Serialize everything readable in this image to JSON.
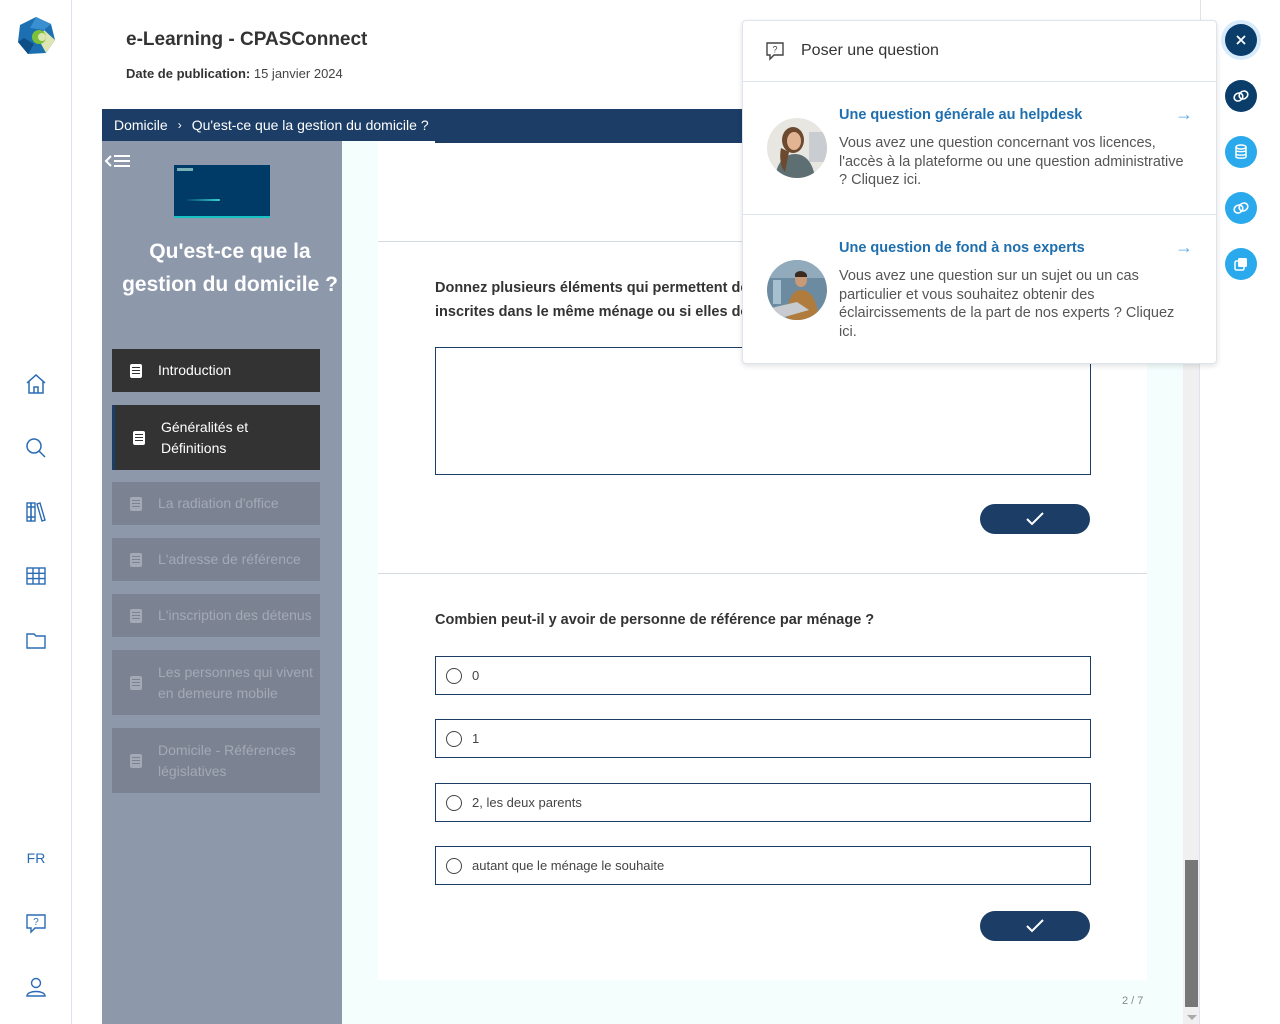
{
  "rail": {
    "logo": "cpas-logo",
    "icons": [
      "home-icon",
      "search-icon",
      "library-icon",
      "grid-icon",
      "folder-icon"
    ],
    "language": "FR",
    "bottom_icons": [
      "help-question-icon",
      "user-icon"
    ]
  },
  "header": {
    "title": "e-Learning - CPASConnect",
    "publication_label": "Date de publication:",
    "publication_date": "15 janvier 2024"
  },
  "breadcrumb": {
    "items": [
      "Domicile",
      "Qu'est-ce que la gestion du domicile ?"
    ]
  },
  "course": {
    "title": "Qu'est-ce que la gestion du domicile ?",
    "chapters": [
      {
        "label": "Introduction",
        "state": "active"
      },
      {
        "label": "Généralités et Définitions",
        "state": "current"
      },
      {
        "label": "La radiation d'office",
        "state": "locked"
      },
      {
        "label": "L'adresse de référence",
        "state": "locked"
      },
      {
        "label": "L'inscription des détenus",
        "state": "locked"
      },
      {
        "label": "Les personnes qui vivent en demeure mobile",
        "state": "locked"
      },
      {
        "label": "Domicile - Références législatives",
        "state": "locked"
      }
    ]
  },
  "content": {
    "question1": {
      "text": "Donnez plusieurs éléments qui permettent de déterminer si des personnes doivent être inscrites dans le même ménage ou si elles doivent être inscrites séparément ?",
      "visible_text_line1": "Donnez plusieurs éléments qui permettent de",
      "visible_text_line2": "inscrites dans le même ménage ou si elles doi",
      "answer_value": ""
    },
    "question2": {
      "text": "Combien peut-il y avoir de personne de référence par ménage ?",
      "options": [
        "0",
        "1",
        "2, les deux parents",
        "autant que le ménage le souhaite"
      ],
      "selected": null
    },
    "submit_icon": "check-icon",
    "pager": "2 / 7"
  },
  "popup": {
    "title": "Poser une question",
    "icon": "question-bubble-icon",
    "items": [
      {
        "title": "Une question générale au helpdesk",
        "description": "Vous avez une question concernant vos licences, l'accès à la plateforme ou une question administrative ? Cliquez ici."
      },
      {
        "title": "Une question de fond à nos experts",
        "description": "Vous avez une question sur un sujet ou un cas particulier et vous souhaitez obtenir des éclaircissements de la part de nos experts ? Cliquez ici."
      }
    ]
  },
  "fabs": [
    "close-icon",
    "link-icon",
    "database-icon",
    "link-icon",
    "copy-icon"
  ],
  "colors": {
    "primary": "#1b3d66",
    "accent_light": "#2aa9ec",
    "link": "#1f6fae",
    "sidebar": "#8d99ab"
  }
}
